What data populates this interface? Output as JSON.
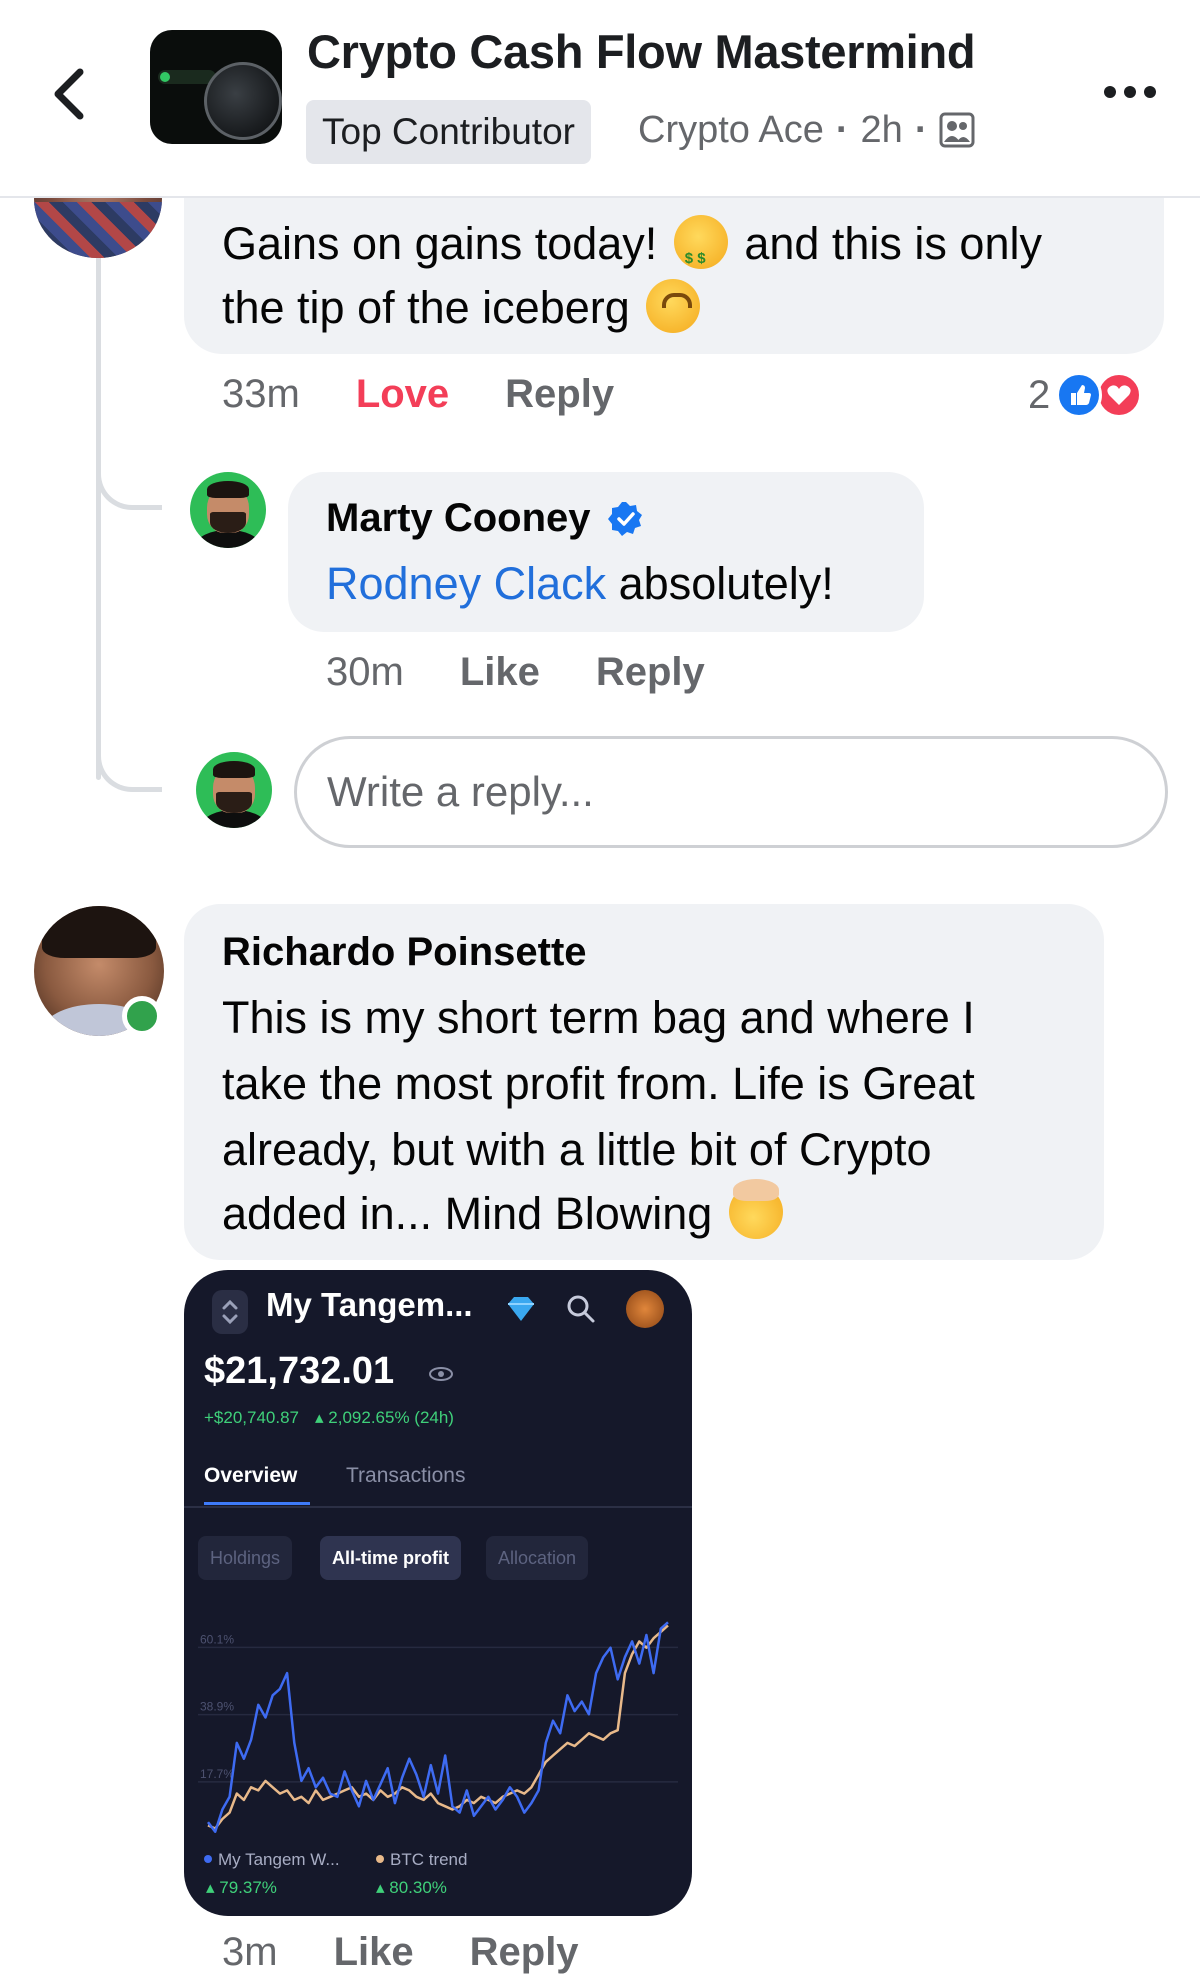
{
  "header": {
    "title": "Crypto Cash Flow Mastermind",
    "badge": "Top Contributor",
    "author": "Crypto Ace",
    "separator": "·",
    "time": "2h"
  },
  "comments": [
    {
      "author": "",
      "text_line1": "Gains on gains today!",
      "text_line1_tail": "and this is only",
      "text_line2": "the tip of the iceberg",
      "emoji1": "money-mouth-face",
      "emoji2": "upside-down-face",
      "time": "33m",
      "reaction_label": "Love",
      "reply_label": "Reply",
      "reaction_count": "2",
      "reactions": [
        "like",
        "love"
      ]
    },
    {
      "author": "Marty Cooney",
      "verified": true,
      "mention": "Rodney Clack",
      "text": "absolutely!",
      "time": "30m",
      "like_label": "Like",
      "reply_label": "Reply"
    },
    {
      "author": "Richardo Poinsette",
      "online": true,
      "lines": [
        "This is my short term bag and where I",
        "take the most profit from. Life is Great",
        "already, but with a little bit of Crypto",
        "added in... Mind Blowing"
      ],
      "emoji": "exploding-head",
      "time": "3m",
      "like_label": "Like",
      "reply_label": "Reply"
    }
  ],
  "reply_box": {
    "placeholder": "Write a reply..."
  },
  "screenshot": {
    "title": "My Tangem...",
    "balance": "$21,732.01",
    "change_abs": "+$20,740.87",
    "change_pct": "▴ 2,092.65% (24h)",
    "tabs": [
      "Overview",
      "Transactions"
    ],
    "pills": [
      "Holdings",
      "All-time profit",
      "Allocation"
    ],
    "legend": [
      {
        "name": "My Tangem W...",
        "pct": "▴ 79.37%",
        "color": "#3e6bf2"
      },
      {
        "name": "BTC trend",
        "pct": "▴ 80.30%",
        "color": "#e8b98a"
      }
    ],
    "chart_data": {
      "type": "line",
      "title": "",
      "xlabel": "",
      "ylabel": "",
      "y_ticks": [
        "60.1%",
        "38.9%",
        "17.7%"
      ],
      "ylim": [
        0,
        70
      ],
      "series": [
        {
          "name": "My Tangem W...",
          "color": "#3e6bf2",
          "values": [
            5,
            2,
            9,
            13,
            30,
            25,
            31,
            42,
            38,
            45,
            47,
            52,
            30,
            18,
            22,
            16,
            19,
            14,
            13,
            21,
            15,
            10,
            18,
            12,
            17,
            22,
            11,
            19,
            25,
            20,
            13,
            23,
            14,
            26,
            10,
            8,
            15,
            7,
            10,
            13,
            9,
            12,
            16,
            13,
            8,
            11,
            15,
            30,
            37,
            33,
            45,
            40,
            43,
            39,
            52,
            57,
            60,
            50,
            57,
            62,
            55,
            64,
            52,
            66,
            68
          ]
        },
        {
          "name": "BTC trend",
          "color": "#e8b98a",
          "values": [
            4,
            3,
            6,
            8,
            14,
            12,
            16,
            15,
            18,
            16,
            14,
            15,
            12,
            13,
            11,
            15,
            12,
            13,
            14,
            15,
            16,
            13,
            14,
            12,
            15,
            13,
            14,
            16,
            15,
            13,
            12,
            14,
            11,
            10,
            9,
            10,
            12,
            11,
            13,
            12,
            11,
            13,
            14,
            15,
            14,
            16,
            20,
            24,
            26,
            28,
            30,
            29,
            31,
            33,
            32,
            31,
            33,
            34,
            52,
            58,
            62,
            60,
            63,
            65,
            67
          ]
        }
      ]
    }
  }
}
